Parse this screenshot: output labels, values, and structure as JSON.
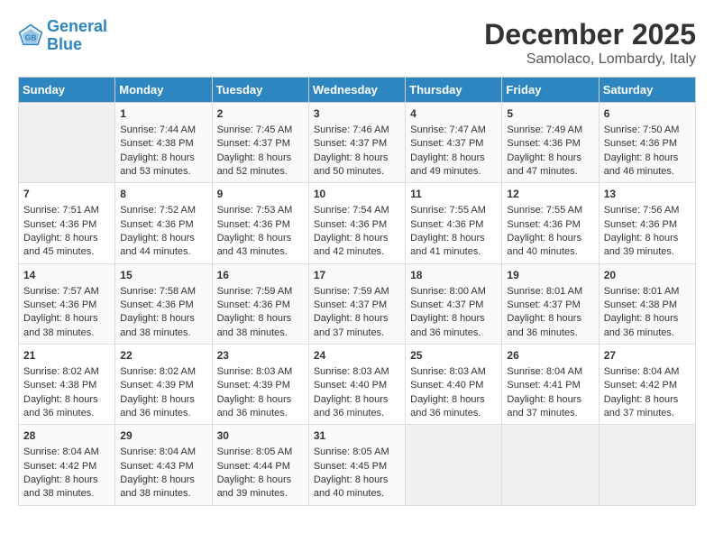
{
  "logo": {
    "line1": "General",
    "line2": "Blue"
  },
  "title": "December 2025",
  "location": "Samolaco, Lombardy, Italy",
  "days_of_week": [
    "Sunday",
    "Monday",
    "Tuesday",
    "Wednesday",
    "Thursday",
    "Friday",
    "Saturday"
  ],
  "weeks": [
    [
      {
        "day": "",
        "sunrise": "",
        "sunset": "",
        "daylight": ""
      },
      {
        "day": "1",
        "sunrise": "Sunrise: 7:44 AM",
        "sunset": "Sunset: 4:38 PM",
        "daylight": "Daylight: 8 hours and 53 minutes."
      },
      {
        "day": "2",
        "sunrise": "Sunrise: 7:45 AM",
        "sunset": "Sunset: 4:37 PM",
        "daylight": "Daylight: 8 hours and 52 minutes."
      },
      {
        "day": "3",
        "sunrise": "Sunrise: 7:46 AM",
        "sunset": "Sunset: 4:37 PM",
        "daylight": "Daylight: 8 hours and 50 minutes."
      },
      {
        "day": "4",
        "sunrise": "Sunrise: 7:47 AM",
        "sunset": "Sunset: 4:37 PM",
        "daylight": "Daylight: 8 hours and 49 minutes."
      },
      {
        "day": "5",
        "sunrise": "Sunrise: 7:49 AM",
        "sunset": "Sunset: 4:36 PM",
        "daylight": "Daylight: 8 hours and 47 minutes."
      },
      {
        "day": "6",
        "sunrise": "Sunrise: 7:50 AM",
        "sunset": "Sunset: 4:36 PM",
        "daylight": "Daylight: 8 hours and 46 minutes."
      }
    ],
    [
      {
        "day": "7",
        "sunrise": "Sunrise: 7:51 AM",
        "sunset": "Sunset: 4:36 PM",
        "daylight": "Daylight: 8 hours and 45 minutes."
      },
      {
        "day": "8",
        "sunrise": "Sunrise: 7:52 AM",
        "sunset": "Sunset: 4:36 PM",
        "daylight": "Daylight: 8 hours and 44 minutes."
      },
      {
        "day": "9",
        "sunrise": "Sunrise: 7:53 AM",
        "sunset": "Sunset: 4:36 PM",
        "daylight": "Daylight: 8 hours and 43 minutes."
      },
      {
        "day": "10",
        "sunrise": "Sunrise: 7:54 AM",
        "sunset": "Sunset: 4:36 PM",
        "daylight": "Daylight: 8 hours and 42 minutes."
      },
      {
        "day": "11",
        "sunrise": "Sunrise: 7:55 AM",
        "sunset": "Sunset: 4:36 PM",
        "daylight": "Daylight: 8 hours and 41 minutes."
      },
      {
        "day": "12",
        "sunrise": "Sunrise: 7:55 AM",
        "sunset": "Sunset: 4:36 PM",
        "daylight": "Daylight: 8 hours and 40 minutes."
      },
      {
        "day": "13",
        "sunrise": "Sunrise: 7:56 AM",
        "sunset": "Sunset: 4:36 PM",
        "daylight": "Daylight: 8 hours and 39 minutes."
      }
    ],
    [
      {
        "day": "14",
        "sunrise": "Sunrise: 7:57 AM",
        "sunset": "Sunset: 4:36 PM",
        "daylight": "Daylight: 8 hours and 38 minutes."
      },
      {
        "day": "15",
        "sunrise": "Sunrise: 7:58 AM",
        "sunset": "Sunset: 4:36 PM",
        "daylight": "Daylight: 8 hours and 38 minutes."
      },
      {
        "day": "16",
        "sunrise": "Sunrise: 7:59 AM",
        "sunset": "Sunset: 4:36 PM",
        "daylight": "Daylight: 8 hours and 38 minutes."
      },
      {
        "day": "17",
        "sunrise": "Sunrise: 7:59 AM",
        "sunset": "Sunset: 4:37 PM",
        "daylight": "Daylight: 8 hours and 37 minutes."
      },
      {
        "day": "18",
        "sunrise": "Sunrise: 8:00 AM",
        "sunset": "Sunset: 4:37 PM",
        "daylight": "Daylight: 8 hours and 36 minutes."
      },
      {
        "day": "19",
        "sunrise": "Sunrise: 8:01 AM",
        "sunset": "Sunset: 4:37 PM",
        "daylight": "Daylight: 8 hours and 36 minutes."
      },
      {
        "day": "20",
        "sunrise": "Sunrise: 8:01 AM",
        "sunset": "Sunset: 4:38 PM",
        "daylight": "Daylight: 8 hours and 36 minutes."
      }
    ],
    [
      {
        "day": "21",
        "sunrise": "Sunrise: 8:02 AM",
        "sunset": "Sunset: 4:38 PM",
        "daylight": "Daylight: 8 hours and 36 minutes."
      },
      {
        "day": "22",
        "sunrise": "Sunrise: 8:02 AM",
        "sunset": "Sunset: 4:39 PM",
        "daylight": "Daylight: 8 hours and 36 minutes."
      },
      {
        "day": "23",
        "sunrise": "Sunrise: 8:03 AM",
        "sunset": "Sunset: 4:39 PM",
        "daylight": "Daylight: 8 hours and 36 minutes."
      },
      {
        "day": "24",
        "sunrise": "Sunrise: 8:03 AM",
        "sunset": "Sunset: 4:40 PM",
        "daylight": "Daylight: 8 hours and 36 minutes."
      },
      {
        "day": "25",
        "sunrise": "Sunrise: 8:03 AM",
        "sunset": "Sunset: 4:40 PM",
        "daylight": "Daylight: 8 hours and 36 minutes."
      },
      {
        "day": "26",
        "sunrise": "Sunrise: 8:04 AM",
        "sunset": "Sunset: 4:41 PM",
        "daylight": "Daylight: 8 hours and 37 minutes."
      },
      {
        "day": "27",
        "sunrise": "Sunrise: 8:04 AM",
        "sunset": "Sunset: 4:42 PM",
        "daylight": "Daylight: 8 hours and 37 minutes."
      }
    ],
    [
      {
        "day": "28",
        "sunrise": "Sunrise: 8:04 AM",
        "sunset": "Sunset: 4:42 PM",
        "daylight": "Daylight: 8 hours and 38 minutes."
      },
      {
        "day": "29",
        "sunrise": "Sunrise: 8:04 AM",
        "sunset": "Sunset: 4:43 PM",
        "daylight": "Daylight: 8 hours and 38 minutes."
      },
      {
        "day": "30",
        "sunrise": "Sunrise: 8:05 AM",
        "sunset": "Sunset: 4:44 PM",
        "daylight": "Daylight: 8 hours and 39 minutes."
      },
      {
        "day": "31",
        "sunrise": "Sunrise: 8:05 AM",
        "sunset": "Sunset: 4:45 PM",
        "daylight": "Daylight: 8 hours and 40 minutes."
      },
      {
        "day": "",
        "sunrise": "",
        "sunset": "",
        "daylight": ""
      },
      {
        "day": "",
        "sunrise": "",
        "sunset": "",
        "daylight": ""
      },
      {
        "day": "",
        "sunrise": "",
        "sunset": "",
        "daylight": ""
      }
    ]
  ]
}
